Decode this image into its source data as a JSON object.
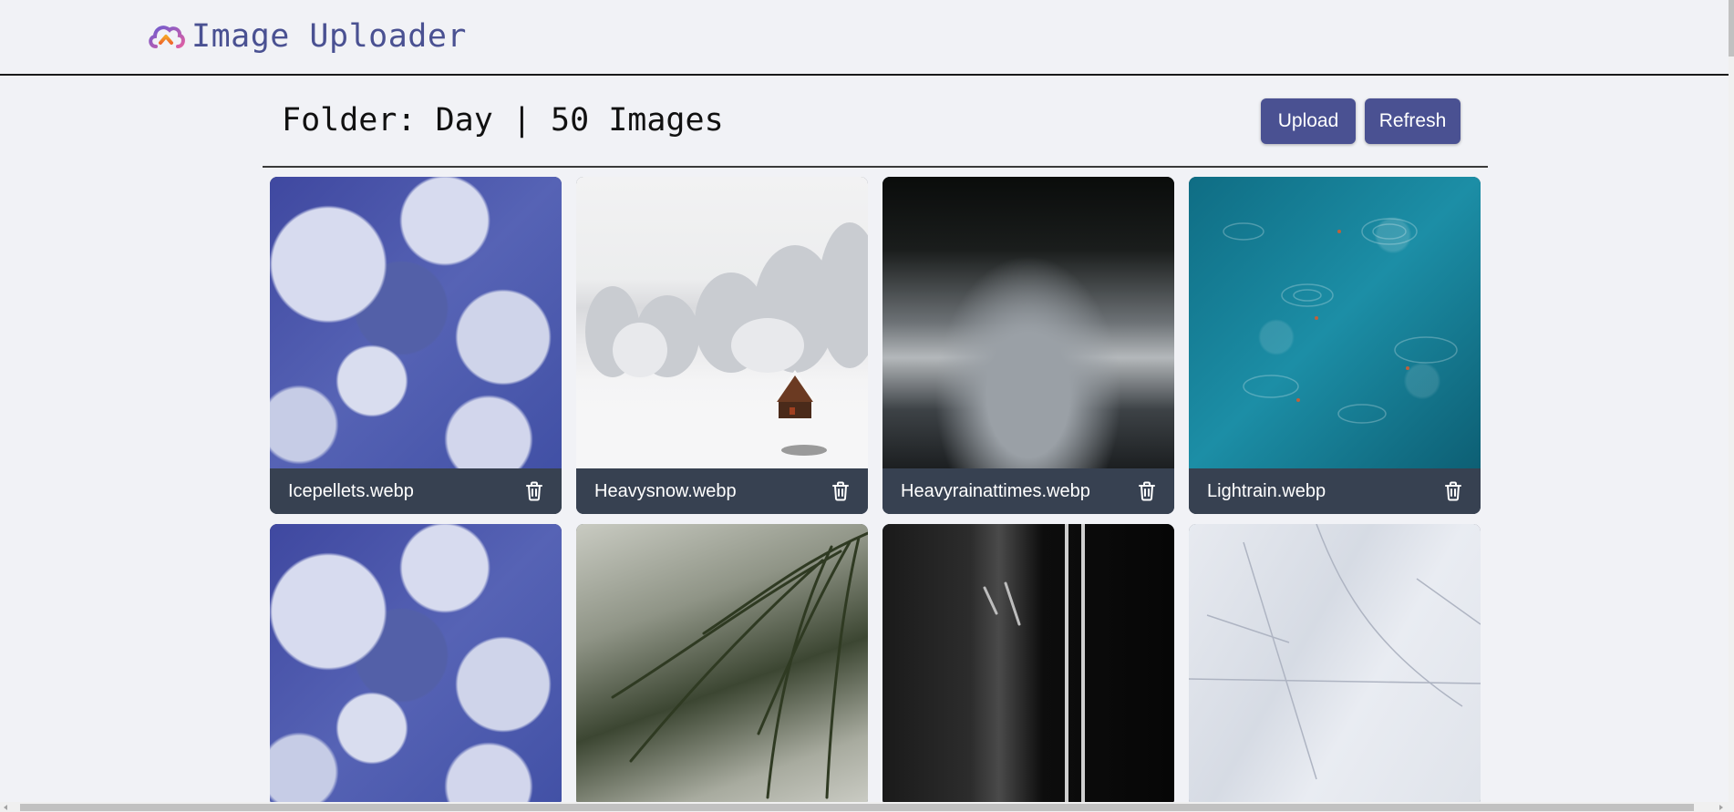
{
  "app": {
    "title": "Image Uploader",
    "brand_icon": "cloud-upload-icon"
  },
  "header": {
    "folder_title": "Folder: Day | 50 Images",
    "upload_label": "Upload",
    "refresh_label": "Refresh"
  },
  "colors": {
    "accent": "#4a5192",
    "caption_bg": "#374151",
    "page_bg": "#f1f2f6"
  },
  "images": [
    {
      "filename": "Icepellets.webp",
      "icon": "trash-icon"
    },
    {
      "filename": "Heavysnow.webp",
      "icon": "trash-icon"
    },
    {
      "filename": "Heavyrainattimes.webp",
      "icon": "trash-icon"
    },
    {
      "filename": "Lightrain.webp",
      "icon": "trash-icon"
    }
  ]
}
